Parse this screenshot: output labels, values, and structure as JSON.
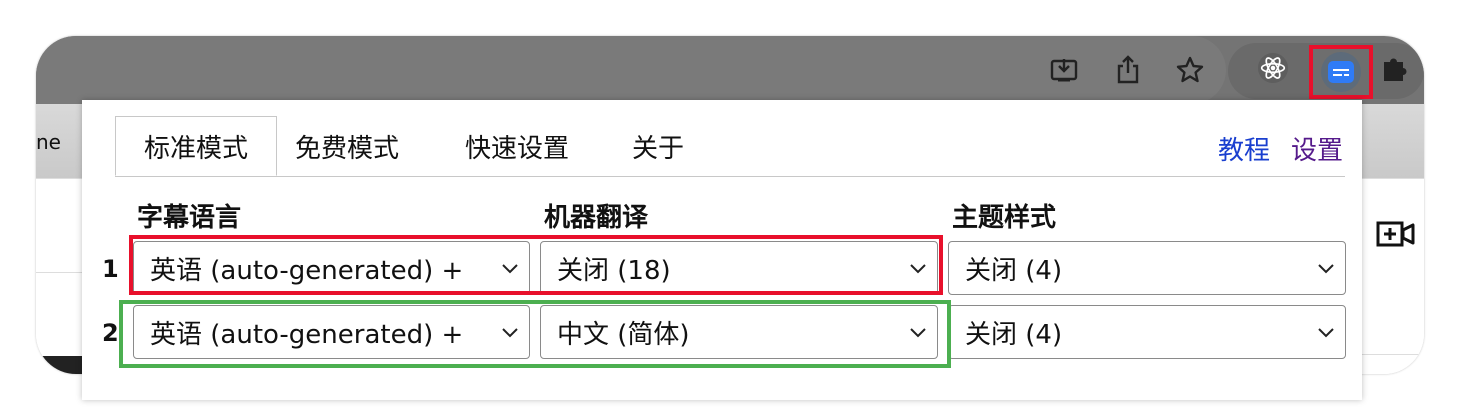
{
  "browser": {
    "partial_tab_text": "ne",
    "toolbar_icons": [
      "install-icon",
      "share-icon",
      "bookmark-star-icon",
      "react-devtools-icon",
      "subtitle-extension-icon",
      "extensions-puzzle-icon"
    ]
  },
  "popup": {
    "tabs": [
      {
        "label": "标准模式",
        "active": true
      },
      {
        "label": "免费模式",
        "active": false
      },
      {
        "label": "快速设置",
        "active": false
      },
      {
        "label": "关于",
        "active": false
      }
    ],
    "links": {
      "tutorial": "教程",
      "settings": "设置"
    },
    "columns": {
      "subtitle_language": "字幕语言",
      "machine_translation": "机器翻译",
      "theme_style": "主题样式"
    },
    "rows": [
      {
        "num": "1",
        "language": "英语 (auto-generated) +",
        "translation": "关闭 (18)",
        "theme": "关闭 (4)"
      },
      {
        "num": "2",
        "language": "英语 (auto-generated) +",
        "translation": "中文 (简体)",
        "theme": "关闭 (4)"
      }
    ]
  },
  "colors": {
    "link_blue": "#1a3fcf",
    "link_purple": "#551a8b",
    "highlight_red": "#e8102b",
    "highlight_green": "#4caf50",
    "extension_blue": "#2f7bf6"
  }
}
